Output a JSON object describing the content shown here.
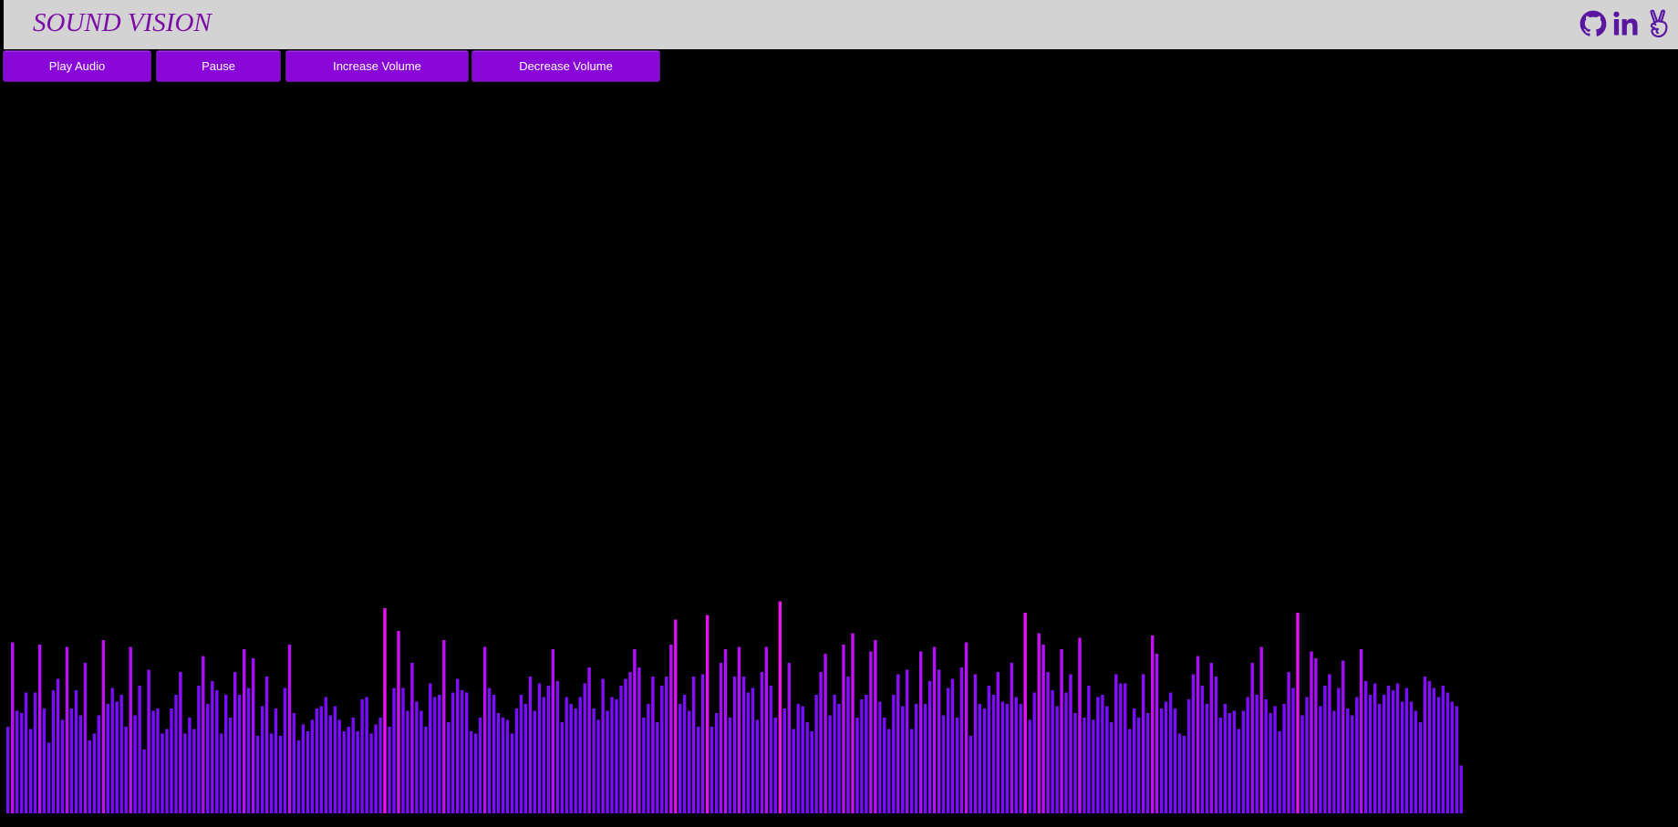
{
  "header": {
    "title": "SOUND VISION",
    "links": [
      {
        "name": "github-icon",
        "label": "GitHub"
      },
      {
        "name": "linkedin-icon",
        "label": "LinkedIn"
      },
      {
        "name": "angellist-icon",
        "label": "AngelList"
      }
    ]
  },
  "controls": {
    "play_label": "Play Audio",
    "pause_label": "Pause",
    "increase_label": "Increase Volume",
    "decrease_label": "Decrease Volume"
  },
  "colors": {
    "accent": "#8a07da",
    "header_bg": "#d3d3d3",
    "title_color": "#7d0ba8",
    "icon_color": "#5a16a0",
    "bar_low": "#7a0cff",
    "bar_high": "#f012f5",
    "background": "#000000"
  },
  "visualizer": {
    "levels": [
      0.38,
      0.75,
      0.45,
      0.44,
      0.53,
      0.37,
      0.53,
      0.74,
      0.46,
      0.31,
      0.54,
      0.59,
      0.41,
      0.73,
      0.46,
      0.54,
      0.43,
      0.66,
      0.32,
      0.35,
      0.43,
      0.76,
      0.48,
      0.55,
      0.49,
      0.52,
      0.38,
      0.73,
      0.43,
      0.56,
      0.28,
      0.63,
      0.45,
      0.46,
      0.35,
      0.37,
      0.46,
      0.52,
      0.62,
      0.35,
      0.42,
      0.37,
      0.56,
      0.69,
      0.48,
      0.58,
      0.54,
      0.35,
      0.52,
      0.42,
      0.62,
      0.52,
      0.72,
      0.55,
      0.68,
      0.34,
      0.47,
      0.6,
      0.35,
      0.46,
      0.34,
      0.55,
      0.74,
      0.44,
      0.32,
      0.39,
      0.36,
      0.41,
      0.46,
      0.47,
      0.51,
      0.43,
      0.47,
      0.41,
      0.36,
      0.38,
      0.42,
      0.36,
      0.5,
      0.51,
      0.35,
      0.39,
      0.42,
      0.9,
      0.38,
      0.55,
      0.8,
      0.55,
      0.45,
      0.66,
      0.49,
      0.45,
      0.38,
      0.57,
      0.51,
      0.52,
      0.76,
      0.4,
      0.53,
      0.59,
      0.54,
      0.53,
      0.36,
      0.35,
      0.42,
      0.73,
      0.55,
      0.52,
      0.44,
      0.42,
      0.41,
      0.35,
      0.46,
      0.52,
      0.48,
      0.6,
      0.45,
      0.57,
      0.51,
      0.56,
      0.72,
      0.58,
      0.4,
      0.51,
      0.48,
      0.46,
      0.51,
      0.57,
      0.64,
      0.46,
      0.41,
      0.59,
      0.45,
      0.51,
      0.5,
      0.56,
      0.59,
      0.62,
      0.72,
      0.64,
      0.42,
      0.48,
      0.6,
      0.4,
      0.56,
      0.6,
      0.74,
      0.85,
      0.48,
      0.52,
      0.45,
      0.6,
      0.38,
      0.61,
      0.87,
      0.38,
      0.44,
      0.66,
      0.72,
      0.42,
      0.6,
      0.73,
      0.6,
      0.53,
      0.55,
      0.41,
      0.62,
      0.73,
      0.56,
      0.42,
      0.93,
      0.46,
      0.66,
      0.37,
      0.48,
      0.47,
      0.4,
      0.36,
      0.52,
      0.62,
      0.7,
      0.43,
      0.52,
      0.48,
      0.74,
      0.6,
      0.79,
      0.42,
      0.5,
      0.52,
      0.71,
      0.76,
      0.49,
      0.42,
      0.37,
      0.52,
      0.61,
      0.47,
      0.63,
      0.37,
      0.48,
      0.71,
      0.48,
      0.58,
      0.73,
      0.63,
      0.43,
      0.55,
      0.59,
      0.42,
      0.64,
      0.75,
      0.34,
      0.61,
      0.48,
      0.46,
      0.56,
      0.52,
      0.62,
      0.49,
      0.48,
      0.66,
      0.51,
      0.48,
      0.88,
      0.41,
      0.53,
      0.79,
      0.74,
      0.62,
      0.54,
      0.47,
      0.72,
      0.53,
      0.61,
      0.44,
      0.77,
      0.42,
      0.56,
      0.41,
      0.51,
      0.52,
      0.47,
      0.4,
      0.61,
      0.57,
      0.57,
      0.37,
      0.46,
      0.42,
      0.61,
      0.44,
      0.78,
      0.7,
      0.46,
      0.49,
      0.53,
      0.46,
      0.35,
      0.34,
      0.5,
      0.61,
      0.69,
      0.56,
      0.48,
      0.66,
      0.6,
      0.42,
      0.48,
      0.44,
      0.45,
      0.37,
      0.45,
      0.51,
      0.66,
      0.52,
      0.73,
      0.5,
      0.44,
      0.47,
      0.36,
      0.48,
      0.62,
      0.55,
      0.88,
      0.43,
      0.51,
      0.71,
      0.68,
      0.47,
      0.56,
      0.61,
      0.45,
      0.55,
      0.67,
      0.46,
      0.43,
      0.51,
      0.72,
      0.58,
      0.52,
      0.57,
      0.48,
      0.52,
      0.56,
      0.54,
      0.57,
      0.49,
      0.55,
      0.49,
      0.45,
      0.4,
      0.6,
      0.58,
      0.55,
      0.51,
      0.56,
      0.53,
      0.49,
      0.47,
      0.21
    ]
  }
}
